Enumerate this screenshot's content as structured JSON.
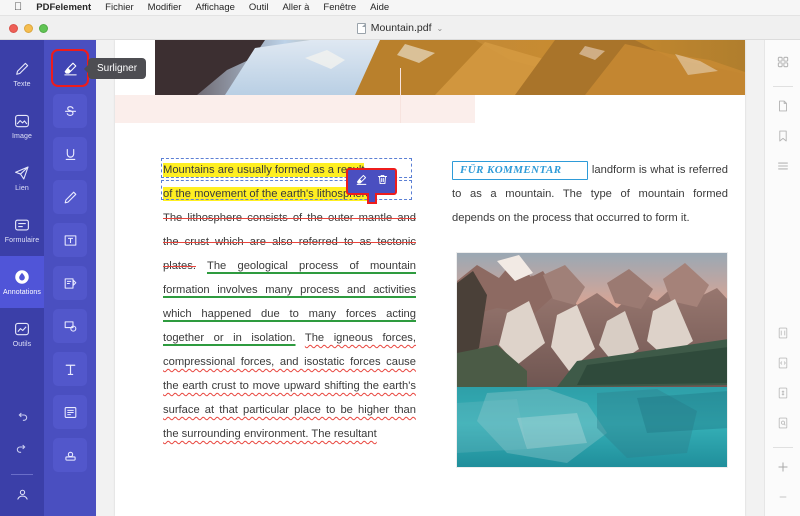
{
  "menubar": {
    "apple_glyph": "",
    "items": [
      {
        "label": "PDFelement",
        "bold": true
      },
      {
        "label": "Fichier"
      },
      {
        "label": "Modifier"
      },
      {
        "label": "Affichage"
      },
      {
        "label": "Outil"
      },
      {
        "label": "Aller à"
      },
      {
        "label": "Fenêtre"
      },
      {
        "label": "Aide"
      }
    ]
  },
  "window": {
    "document_title": "Mountain.pdf",
    "chevron": "⌄",
    "traffic_lights": [
      "close-button",
      "minimize-button",
      "zoom-button"
    ]
  },
  "sidebar": {
    "items": [
      {
        "label": "Texte",
        "icon": "pen-icon",
        "active": false
      },
      {
        "label": "Image",
        "icon": "image-icon",
        "active": false
      },
      {
        "label": "Lien",
        "icon": "link-send-icon",
        "active": false
      },
      {
        "label": "Formulaire",
        "icon": "form-icon",
        "active": false
      },
      {
        "label": "Annotations",
        "icon": "annotation-drop-icon",
        "active": true
      },
      {
        "label": "Outils",
        "icon": "tools-icon",
        "active": false
      }
    ],
    "bottom": [
      {
        "icon": "undo-icon"
      },
      {
        "icon": "redo-icon"
      },
      {
        "icon": "account-icon"
      }
    ]
  },
  "toolcolumn": {
    "tools": [
      {
        "icon": "highlighter-icon",
        "name": "highlight-tool",
        "selected": true
      },
      {
        "icon": "strikethrough-icon",
        "name": "strikethrough-tool",
        "selected": false
      },
      {
        "icon": "underline-icon",
        "name": "underline-tool",
        "selected": false
      },
      {
        "icon": "pencil-icon",
        "name": "pencil-tool",
        "selected": false
      },
      {
        "icon": "text-box-icon",
        "name": "text-box-tool",
        "selected": false
      },
      {
        "icon": "note-icon",
        "name": "sticky-note-tool",
        "selected": false
      },
      {
        "icon": "shape-icon",
        "name": "shape-tool",
        "selected": false
      },
      {
        "icon": "typewriter-icon",
        "name": "typewriter-tool",
        "selected": false
      },
      {
        "icon": "text-callout-icon",
        "name": "text-callout-tool",
        "selected": false
      },
      {
        "icon": "stamp-icon",
        "name": "stamp-tool",
        "selected": false
      }
    ]
  },
  "tooltip": {
    "text": "Surligner"
  },
  "floating_toolbar": {
    "buttons": [
      {
        "icon": "highlighter-icon",
        "name": "apply-highlight-button"
      },
      {
        "icon": "trash-icon",
        "name": "delete-annotation-button"
      }
    ]
  },
  "document": {
    "left_column": {
      "highlighted_line_1": "Mountains are usually formed as a result",
      "highlighted_line_2": "of the movement of the earth's lithosphere.",
      "struck_text": "The lithosphere consists of the outer mantle and the crust which are also referred to as tectonic plates.",
      "green_underlined_text": "The geological process of mountain formation involves many process and activities which happened due to many forces acting together or in isolation.",
      "squiggly_text": "The igneous forces, compressional forces, and isostatic forces cause the earth crust to move upward shifting the earth's surface at that particular place to be higher than the surrounding environment. The resultant"
    },
    "right_column": {
      "stamp_label": "FÜR KOMMENTAR",
      "body_text": "landform is what is referred to as a mountain. The type of mountain formed depends on the process that occurred to form it."
    },
    "images": [
      {
        "name": "banner-mountain-photo"
      },
      {
        "name": "lake-mountain-photo"
      }
    ]
  },
  "right_rail": {
    "items": [
      {
        "icon": "thumbnails-grid-icon",
        "name": "panel-thumbnails"
      },
      {
        "icon": "page-icon",
        "name": "panel-pages"
      },
      {
        "icon": "bookmark-icon",
        "name": "panel-bookmarks"
      },
      {
        "icon": "outline-list-icon",
        "name": "panel-outline"
      },
      {
        "icon": "document-properties-icon",
        "name": "panel-properties"
      },
      {
        "icon": "document-compare-icon",
        "name": "panel-compare"
      },
      {
        "icon": "document-sign-icon",
        "name": "panel-signature"
      },
      {
        "icon": "document-search-icon",
        "name": "panel-search"
      },
      {
        "icon": "plus-icon",
        "name": "zoom-in-button"
      },
      {
        "icon": "minus-icon",
        "name": "zoom-out-button"
      }
    ]
  },
  "colors": {
    "rail_bg": "#3b3fa8",
    "toolcol_bg": "#4a4fc0",
    "active_item": "#5055d8",
    "selection_red": "#ee1c1c",
    "highlight_yellow": "#ffef21",
    "strike_red": "#e8443c",
    "underline_green": "#2e9b3f",
    "stamp_blue": "#2e9bd8",
    "pink_band": "#fbeeeb"
  }
}
